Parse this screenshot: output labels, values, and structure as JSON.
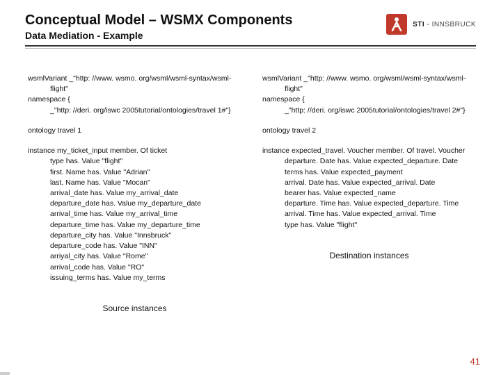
{
  "header": {
    "title": "Conceptual Model – WSMX Components",
    "subtitle": "Data Mediation - Example"
  },
  "logo": {
    "brand_strong": "STI",
    "brand_light": " - INNSBRUCK"
  },
  "left": {
    "variant_line": "wsmlVariant _\"http: //www. wsmo. org/wsml/wsml-syntax/wsml-",
    "variant_cont": "flight\"",
    "ns_open": "namespace {",
    "ns_value": "_\"http: //deri. org/iswc 2005tutorial/ontologies/travel 1#\"}",
    "ontology": "ontology travel 1",
    "instance_head": "instance my_ticket_input member. Of ticket",
    "lines": [
      "type has. Value \"flight\"",
      "first. Name has. Value \"Adrian\"",
      "last. Name has. Value \"Mocan\"",
      "arrival_date has. Value my_arrival_date",
      "departure_date has. Value my_departure_date",
      "arrival_time has. Value my_arrival_time",
      "departure_time has. Value my_departure_time",
      "departure_city has. Value \"Innsbruck\"",
      "departure_code has. Value \"INN\"",
      "arriyal_city has. Value \"Rome\"",
      "arrival_code has. Value \"RO\"",
      "issuing_terms has. Value my_terms"
    ],
    "caption": "Source instances"
  },
  "right": {
    "variant_line": "wsmlVariant _\"http: //www. wsmo. org/wsml/wsml-syntax/wsml-",
    "variant_cont": "flight\"",
    "ns_open": "namespace {",
    "ns_value": "_\"http: //deri. org/iswc 2005tutorial/ontologies/travel 2#\"}",
    "ontology": "ontology travel 2",
    "instance_head": "instance expected_travel. Voucher member. Of travel. Voucher",
    "lines": [
      "departure. Date has. Value expected_departure. Date",
      "terms has. Value expected_payment",
      "arrival. Date has. Value expected_arrival. Date",
      "bearer has. Value expected_name",
      "departure. Time has. Value expected_departure. Time",
      "arrival. Time has. Value expected_arrival. Time",
      "type has. Value \"flight\""
    ],
    "caption": "Destination instances"
  },
  "page": "41"
}
